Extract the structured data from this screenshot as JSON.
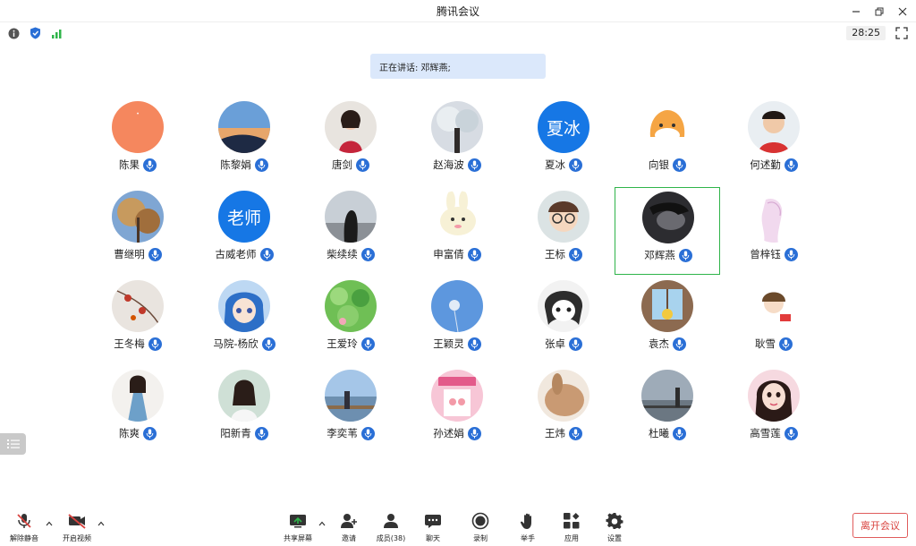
{
  "window": {
    "title": "腾讯会议"
  },
  "infobar": {
    "timer": "28:25"
  },
  "speaking_text": "正在讲话: 邓辉燕;",
  "participants": [
    {
      "name": "陈果",
      "avatar": "orange"
    },
    {
      "name": "陈黎娟",
      "avatar": "sky"
    },
    {
      "name": "唐剑",
      "avatar": "girl-red"
    },
    {
      "name": "赵海波",
      "avatar": "tree"
    },
    {
      "name": "夏冰",
      "avatar": "text",
      "text": "夏冰"
    },
    {
      "name": "向银",
      "avatar": "cartoon-orange"
    },
    {
      "name": "何述勤",
      "avatar": "kid"
    },
    {
      "name": "曹继明",
      "avatar": "autumn"
    },
    {
      "name": "古威老师",
      "avatar": "text",
      "text": "老师"
    },
    {
      "name": "柴续续",
      "avatar": "city"
    },
    {
      "name": "申富倩",
      "avatar": "bunny"
    },
    {
      "name": "王标",
      "avatar": "glasses"
    },
    {
      "name": "邓辉燕",
      "avatar": "dark",
      "active": true
    },
    {
      "name": "曾梓钰",
      "avatar": "sketch"
    },
    {
      "name": "王冬梅",
      "avatar": "fruit"
    },
    {
      "name": "马院-杨欣",
      "avatar": "anime"
    },
    {
      "name": "王爱玲",
      "avatar": "leaf"
    },
    {
      "name": "王颖灵",
      "avatar": "dandelion"
    },
    {
      "name": "张卓",
      "avatar": "bw-girl"
    },
    {
      "name": "袁杰",
      "avatar": "window"
    },
    {
      "name": "耿雪",
      "avatar": "paper-doll"
    },
    {
      "name": "陈爽",
      "avatar": "doll"
    },
    {
      "name": "阳新青",
      "avatar": "girl-white"
    },
    {
      "name": "李奕苇",
      "avatar": "lake"
    },
    {
      "name": "孙述娟",
      "avatar": "pink"
    },
    {
      "name": "王炜",
      "avatar": "rabbit"
    },
    {
      "name": "杜曦",
      "avatar": "coast"
    },
    {
      "name": "高雪莲",
      "avatar": "doll2"
    }
  ],
  "toolbar": {
    "unmute": "解除静音",
    "video": "开启视频",
    "share": "共享屏幕",
    "invite": "邀请",
    "members": "成员(38)",
    "chat": "聊天",
    "record": "录制",
    "hand": "举手",
    "apps": "应用",
    "settings": "设置",
    "leave": "离开会议"
  },
  "colors": {
    "accent": "#2a6fd6",
    "active_border": "#2fb44a",
    "leave": "#d9433f"
  }
}
